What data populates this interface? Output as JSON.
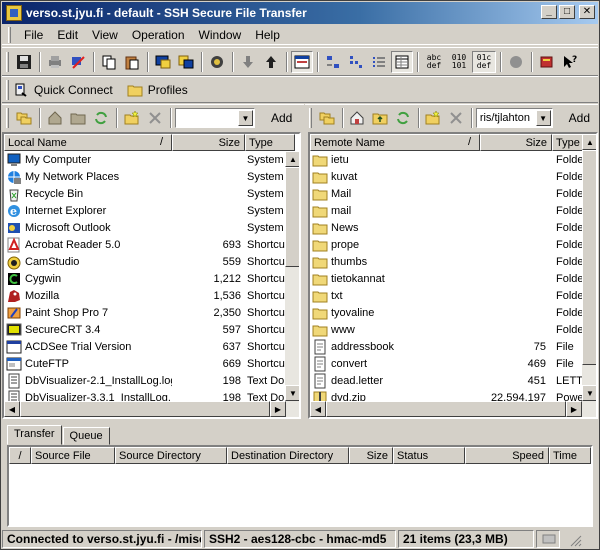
{
  "window": {
    "title": "verso.st.jyu.fi - default - SSH Secure File Transfer"
  },
  "menu": [
    "File",
    "Edit",
    "View",
    "Operation",
    "Window",
    "Help"
  ],
  "toolbar": {
    "binary_label": "010 101",
    "ascii_label": "abc def",
    "auto_label": "01c def"
  },
  "quick": {
    "connect_label": "Quick Connect",
    "profiles_label": "Profiles"
  },
  "local": {
    "combo_value": "",
    "add_label": "Add",
    "columns": {
      "name": "Local Name",
      "sort": "/",
      "size": "Size",
      "type": "Type"
    },
    "rows": [
      {
        "name": "My Computer",
        "size": "",
        "type": "System F",
        "icon": "computer"
      },
      {
        "name": "My Network Places",
        "size": "",
        "type": "System F",
        "icon": "network"
      },
      {
        "name": "Recycle Bin",
        "size": "",
        "type": "System F",
        "icon": "recycle"
      },
      {
        "name": "Internet Explorer",
        "size": "",
        "type": "System F",
        "icon": "ie"
      },
      {
        "name": "Microsoft Outlook",
        "size": "",
        "type": "System F",
        "icon": "outlook"
      },
      {
        "name": "Acrobat Reader 5.0",
        "size": "693",
        "type": "Shortcut",
        "icon": "acrobat"
      },
      {
        "name": "CamStudio",
        "size": "559",
        "type": "Shortcut",
        "icon": "camstudio"
      },
      {
        "name": "Cygwin",
        "size": "1,212",
        "type": "Shortcut",
        "icon": "cygwin"
      },
      {
        "name": "Mozilla",
        "size": "1,536",
        "type": "Shortcut",
        "icon": "mozilla"
      },
      {
        "name": "Paint Shop Pro 7",
        "size": "2,350",
        "type": "Shortcut",
        "icon": "psp"
      },
      {
        "name": "SecureCRT 3.4",
        "size": "597",
        "type": "Shortcut",
        "icon": "crt"
      },
      {
        "name": "ACDSee Trial Version",
        "size": "637",
        "type": "Shortcut",
        "icon": "acdsee"
      },
      {
        "name": "CuteFTP",
        "size": "669",
        "type": "Shortcut",
        "icon": "cuteftp"
      },
      {
        "name": "DbVisualizer-2.1_InstallLog.log",
        "size": "198",
        "type": "Text Do",
        "icon": "text"
      },
      {
        "name": "DbVisualizer-3.3.1_InstallLog....",
        "size": "198",
        "type": "Text Do",
        "icon": "text"
      }
    ]
  },
  "remote": {
    "combo_value": "ris/tjlahton",
    "add_label": "Add",
    "columns": {
      "name": "Remote Name",
      "sort": "/",
      "size": "Size",
      "type": "Type"
    },
    "rows": [
      {
        "name": "ietu",
        "size": "",
        "type": "Folde",
        "icon": "folder"
      },
      {
        "name": "kuvat",
        "size": "",
        "type": "Folde",
        "icon": "folder"
      },
      {
        "name": "Mail",
        "size": "",
        "type": "Folde",
        "icon": "folder"
      },
      {
        "name": "mail",
        "size": "",
        "type": "Folde",
        "icon": "folder"
      },
      {
        "name": "News",
        "size": "",
        "type": "Folde",
        "icon": "folder"
      },
      {
        "name": "prope",
        "size": "",
        "type": "Folde",
        "icon": "folder"
      },
      {
        "name": "thumbs",
        "size": "",
        "type": "Folde",
        "icon": "folder"
      },
      {
        "name": "tietokannat",
        "size": "",
        "type": "Folde",
        "icon": "folder"
      },
      {
        "name": "txt",
        "size": "",
        "type": "Folde",
        "icon": "folder"
      },
      {
        "name": "tyovaline",
        "size": "",
        "type": "Folde",
        "icon": "folder"
      },
      {
        "name": "www",
        "size": "",
        "type": "Folde",
        "icon": "folder"
      },
      {
        "name": "addressbook",
        "size": "75",
        "type": "File",
        "icon": "file"
      },
      {
        "name": "convert",
        "size": "469",
        "type": "File",
        "icon": "file"
      },
      {
        "name": "dead.letter",
        "size": "451",
        "type": "LETT",
        "icon": "file"
      },
      {
        "name": "dvd.zip",
        "size": "22,594,197",
        "type": "Powe",
        "icon": "zip"
      }
    ]
  },
  "transfer": {
    "tabs": [
      "Transfer",
      "Queue"
    ],
    "columns": [
      "/",
      "Source File",
      "Source Directory",
      "Destination Directory",
      "Size",
      "Status",
      "Speed",
      "Time"
    ]
  },
  "status": {
    "connection": "Connected to verso.st.jyu.fi - /misc",
    "cipher": "SSH2 - aes128-cbc - hmac-md5",
    "items": "21 items (23,3 MB)"
  }
}
